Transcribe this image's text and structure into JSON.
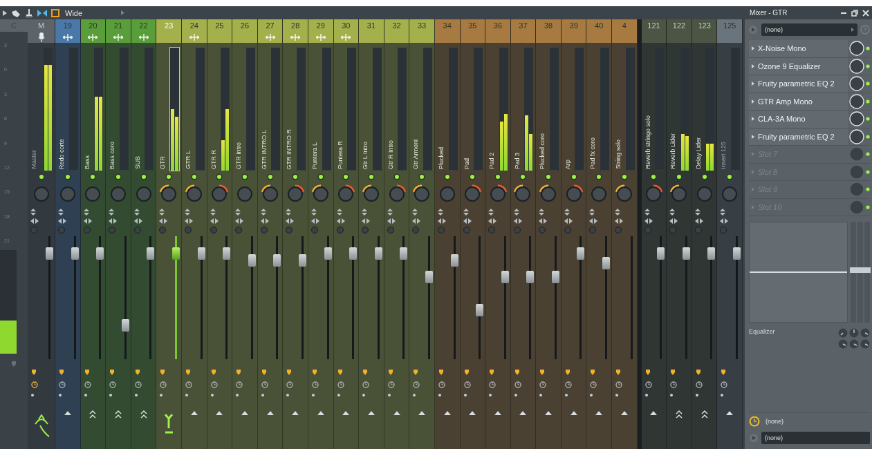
{
  "toolbar": {
    "preset": "Wide"
  },
  "window": {
    "title": "Mixer - GTR"
  },
  "ruler": {
    "header": "C",
    "labels": [
      "3",
      "0",
      "3",
      "6",
      "9",
      "12",
      "15",
      "18",
      "21"
    ],
    "meter": {
      "level": 0.32
    }
  },
  "master": {
    "kind": "master",
    "number": "M",
    "name": "Master",
    "dimmed": true,
    "selected": false,
    "routed": false,
    "color": "#5c646a",
    "meter": [
      {
        "level": 0.86
      },
      {
        "level": 0.86
      }
    ],
    "pan": {
      "kind": "center"
    },
    "fader": {
      "level": 0.9
    },
    "send": {
      "kind": "curve"
    }
  },
  "strip_groups": [
    {
      "channels": [
        {
          "kind": "insert",
          "number": "19",
          "name": "Redo corte",
          "dimmed": false,
          "selected": false,
          "routed": true,
          "color": "#4a78a8",
          "meter": [
            {
              "level": 0
            },
            {
              "level": 0
            }
          ],
          "pan": {
            "kind": "center"
          },
          "fader": {
            "level": 0.9
          },
          "send": {
            "kind": "up"
          }
        },
        {
          "kind": "insert",
          "number": "20",
          "name": "Bass",
          "dimmed": false,
          "selected": false,
          "routed": true,
          "color": "#5a9e3c",
          "meter": [
            {
              "level": 0.6
            },
            {
              "level": 0.6
            }
          ],
          "pan": {
            "kind": "center"
          },
          "fader": {
            "level": 0.9
          },
          "send": {
            "kind": "up2"
          }
        },
        {
          "kind": "insert",
          "number": "21",
          "name": "Bass coro",
          "dimmed": false,
          "selected": false,
          "routed": true,
          "color": "#5a9e3c",
          "meter": [
            {
              "level": 0
            },
            {
              "level": 0
            }
          ],
          "pan": {
            "kind": "center"
          },
          "fader": {
            "level": 0.25
          },
          "send": {
            "kind": "up2"
          }
        },
        {
          "kind": "insert",
          "number": "22",
          "name": "SUB",
          "dimmed": false,
          "selected": false,
          "routed": true,
          "color": "#5a9e3c",
          "meter": [
            {
              "level": 0
            },
            {
              "level": 0
            }
          ],
          "pan": {
            "kind": "center"
          },
          "fader": {
            "level": 0.9
          },
          "send": {
            "kind": "up2"
          }
        },
        {
          "kind": "insert",
          "number": "23",
          "name": "GTR",
          "dimmed": false,
          "selected": true,
          "routed": false,
          "color": "#a4b04c",
          "meter": [
            {
              "level": 0.5
            },
            {
              "level": 0.44
            }
          ],
          "pan": {
            "kind": "left"
          },
          "fader": {
            "level": 0.9
          },
          "send": {
            "kind": "down"
          }
        },
        {
          "kind": "insert",
          "number": "24",
          "name": "GTR L",
          "dimmed": false,
          "selected": false,
          "routed": true,
          "color": "#a4b04c",
          "meter": [
            {
              "level": 0
            },
            {
              "level": 0
            }
          ],
          "pan": {
            "kind": "left"
          },
          "fader": {
            "level": 0.9
          },
          "send": {
            "kind": "up"
          }
        },
        {
          "kind": "insert",
          "number": "25",
          "name": "GTR R",
          "dimmed": false,
          "selected": false,
          "routed": false,
          "color": "#a4b04c",
          "meter": [
            {
              "level": 0.25
            },
            {
              "level": 0.5
            }
          ],
          "pan": {
            "kind": "right"
          },
          "fader": {
            "level": 0.9
          },
          "send": {
            "kind": "up"
          }
        },
        {
          "kind": "insert",
          "number": "26",
          "name": "GTR intro",
          "dimmed": false,
          "selected": false,
          "routed": false,
          "color": "#a4b04c",
          "meter": [
            {
              "level": 0
            },
            {
              "level": 0
            }
          ],
          "pan": {
            "kind": "center"
          },
          "fader": {
            "level": 0.84
          },
          "send": {
            "kind": "up"
          }
        },
        {
          "kind": "insert",
          "number": "27",
          "name": "GTR INTRO L",
          "dimmed": false,
          "selected": false,
          "routed": true,
          "color": "#a4b04c",
          "meter": [
            {
              "level": 0
            },
            {
              "level": 0
            }
          ],
          "pan": {
            "kind": "left"
          },
          "fader": {
            "level": 0.84
          },
          "send": {
            "kind": "up"
          }
        },
        {
          "kind": "insert",
          "number": "28",
          "name": "GTR INTRO R",
          "dimmed": false,
          "selected": false,
          "routed": true,
          "color": "#a4b04c",
          "meter": [
            {
              "level": 0
            },
            {
              "level": 0
            }
          ],
          "pan": {
            "kind": "right"
          },
          "fader": {
            "level": 0.84
          },
          "send": {
            "kind": "up"
          }
        },
        {
          "kind": "insert",
          "number": "29",
          "name": "Puntera L",
          "dimmed": false,
          "selected": false,
          "routed": true,
          "color": "#a4b04c",
          "meter": [
            {
              "level": 0
            },
            {
              "level": 0
            }
          ],
          "pan": {
            "kind": "left"
          },
          "fader": {
            "level": 0.9
          },
          "send": {
            "kind": "up"
          }
        },
        {
          "kind": "insert",
          "number": "30",
          "name": "Puntera R",
          "dimmed": false,
          "selected": false,
          "routed": true,
          "color": "#a4b04c",
          "meter": [
            {
              "level": 0
            },
            {
              "level": 0
            }
          ],
          "pan": {
            "kind": "right"
          },
          "fader": {
            "level": 0.9
          },
          "send": {
            "kind": "up"
          }
        },
        {
          "kind": "insert",
          "number": "31",
          "name": "Gtr L Intro",
          "dimmed": false,
          "selected": false,
          "routed": false,
          "color": "#a4b04c",
          "meter": [
            {
              "level": 0
            },
            {
              "level": 0
            }
          ],
          "pan": {
            "kind": "left"
          },
          "fader": {
            "level": 0.9
          },
          "send": {
            "kind": "up"
          }
        },
        {
          "kind": "insert",
          "number": "32",
          "name": "Gtr R Intro",
          "dimmed": false,
          "selected": false,
          "routed": false,
          "color": "#a4b04c",
          "meter": [
            {
              "level": 0
            },
            {
              "level": 0
            }
          ],
          "pan": {
            "kind": "right"
          },
          "fader": {
            "level": 0.9
          },
          "send": {
            "kind": "up"
          }
        },
        {
          "kind": "insert",
          "number": "33",
          "name": "Gtr Armoni",
          "dimmed": false,
          "selected": false,
          "routed": false,
          "color": "#a4b04c",
          "meter": [
            {
              "level": 0
            },
            {
              "level": 0
            }
          ],
          "pan": {
            "kind": "left"
          },
          "fader": {
            "level": 0.69
          },
          "send": {
            "kind": "up"
          }
        },
        {
          "kind": "insert",
          "number": "34",
          "name": "Plucked",
          "dimmed": false,
          "selected": false,
          "routed": false,
          "color": "#a67a40",
          "meter": [
            {
              "level": 0
            },
            {
              "level": 0
            }
          ],
          "pan": {
            "kind": "center"
          },
          "fader": {
            "level": 0.84
          },
          "send": {
            "kind": "up"
          }
        },
        {
          "kind": "insert",
          "number": "35",
          "name": "Pad",
          "dimmed": false,
          "selected": false,
          "routed": false,
          "color": "#a67a40",
          "meter": [
            {
              "level": 0
            },
            {
              "level": 0
            }
          ],
          "pan": {
            "kind": "right"
          },
          "fader": {
            "level": 0.39
          },
          "send": {
            "kind": "up"
          }
        },
        {
          "kind": "insert",
          "number": "36",
          "name": "Pad 2",
          "dimmed": false,
          "selected": false,
          "routed": false,
          "color": "#a67a40",
          "meter": [
            {
              "level": 0.4
            },
            {
              "level": 0.46
            }
          ],
          "pan": {
            "kind": "right"
          },
          "fader": {
            "level": 0.69
          },
          "send": {
            "kind": "up"
          }
        },
        {
          "kind": "insert",
          "number": "37",
          "name": "Pad 3",
          "dimmed": false,
          "selected": false,
          "routed": false,
          "color": "#a67a40",
          "meter": [
            {
              "level": 0.45
            },
            {
              "level": 0.3
            }
          ],
          "pan": {
            "kind": "left"
          },
          "fader": {
            "level": 0.69
          },
          "send": {
            "kind": "up"
          }
        },
        {
          "kind": "insert",
          "number": "38",
          "name": "Plucked coro",
          "dimmed": false,
          "selected": false,
          "routed": false,
          "color": "#a67a40",
          "meter": [
            {
              "level": 0
            },
            {
              "level": 0
            }
          ],
          "pan": {
            "kind": "left"
          },
          "fader": {
            "level": 0.69
          },
          "send": {
            "kind": "up"
          }
        },
        {
          "kind": "insert",
          "number": "39",
          "name": "Arp",
          "dimmed": false,
          "selected": false,
          "routed": false,
          "color": "#a67a40",
          "meter": [
            {
              "level": 0
            },
            {
              "level": 0
            }
          ],
          "pan": {
            "kind": "right"
          },
          "fader": {
            "level": 0.9
          },
          "send": {
            "kind": "up"
          }
        },
        {
          "kind": "insert",
          "number": "40",
          "name": "Pad fx coro",
          "dimmed": false,
          "selected": false,
          "routed": false,
          "color": "#a67a40",
          "meter": [
            {
              "level": 0
            },
            {
              "level": 0
            }
          ],
          "pan": {
            "kind": "center"
          },
          "fader": {
            "level": 0.81
          },
          "send": {
            "kind": "up"
          }
        },
        {
          "kind": "insert",
          "number": "4",
          "name": "String solo",
          "dimmed": false,
          "selected": false,
          "routed": false,
          "color": "#a67a40",
          "meter": [
            {
              "level": 0
            },
            {
              "level": 0
            }
          ],
          "pan": {
            "kind": "left"
          },
          "send": {
            "kind": "up"
          }
        }
      ]
    },
    {
      "channels": [
        {
          "kind": "insert",
          "number": "121",
          "name": "Reverb stringo solo",
          "dimmed": false,
          "selected": false,
          "routed": false,
          "color": "#4c5544",
          "meter": [
            {
              "level": 0
            },
            {
              "level": 0
            }
          ],
          "pan": {
            "kind": "right"
          },
          "fader": {
            "level": 0.9
          },
          "send": {
            "kind": "up"
          }
        },
        {
          "kind": "insert",
          "number": "122",
          "name": "Reverb Lider",
          "dimmed": false,
          "selected": false,
          "routed": false,
          "color": "#4c5544",
          "meter": [
            {
              "level": 0.3
            },
            {
              "level": 0.28
            }
          ],
          "pan": {
            "kind": "left"
          },
          "fader": {
            "level": 0.9
          },
          "send": {
            "kind": "up2"
          }
        },
        {
          "kind": "insert",
          "number": "123",
          "name": "Delay Lider",
          "dimmed": false,
          "selected": false,
          "routed": false,
          "color": "#4c5544",
          "meter": [
            {
              "level": 0.22
            },
            {
              "level": 0.22
            }
          ],
          "pan": {
            "kind": "center"
          },
          "fader": {
            "level": 0.9
          },
          "send": {
            "kind": "up2"
          }
        },
        {
          "kind": "insert",
          "number": "125",
          "name": "Insert 125",
          "dimmed": true,
          "selected": false,
          "routed": false,
          "color": "#6a747c",
          "meter": [
            {
              "level": 0
            },
            {
              "level": 0
            }
          ],
          "pan": {
            "kind": "center"
          },
          "fader": {
            "level": 0.9
          },
          "send": {
            "kind": "up"
          }
        }
      ]
    }
  ],
  "panel": {
    "input": "(none)",
    "slots": [
      {
        "name": "X-Noise Mono",
        "empty": false,
        "on": true
      },
      {
        "name": "Ozone 9 Equalizer",
        "empty": false,
        "on": true
      },
      {
        "name": "Fruity parametric EQ 2",
        "empty": false,
        "on": true
      },
      {
        "name": "GTR Amp Mono",
        "empty": false,
        "on": true
      },
      {
        "name": "CLA-3A Mono",
        "empty": false,
        "on": true
      },
      {
        "name": "Fruity parametric EQ 2",
        "empty": false,
        "on": true
      },
      {
        "name": "Slot 7",
        "empty": true,
        "on": true
      },
      {
        "name": "Slot 8",
        "empty": true,
        "on": true
      },
      {
        "name": "Slot 9",
        "empty": true,
        "on": true
      },
      {
        "name": "Slot 10",
        "empty": true,
        "on": true
      }
    ],
    "eq": {
      "label": "Equalizer",
      "bands": [
        {
          "level": 0.52
        },
        {
          "level": 0.52
        },
        {
          "level": 0.52
        }
      ]
    },
    "time": "(none)",
    "output": "(none)"
  }
}
